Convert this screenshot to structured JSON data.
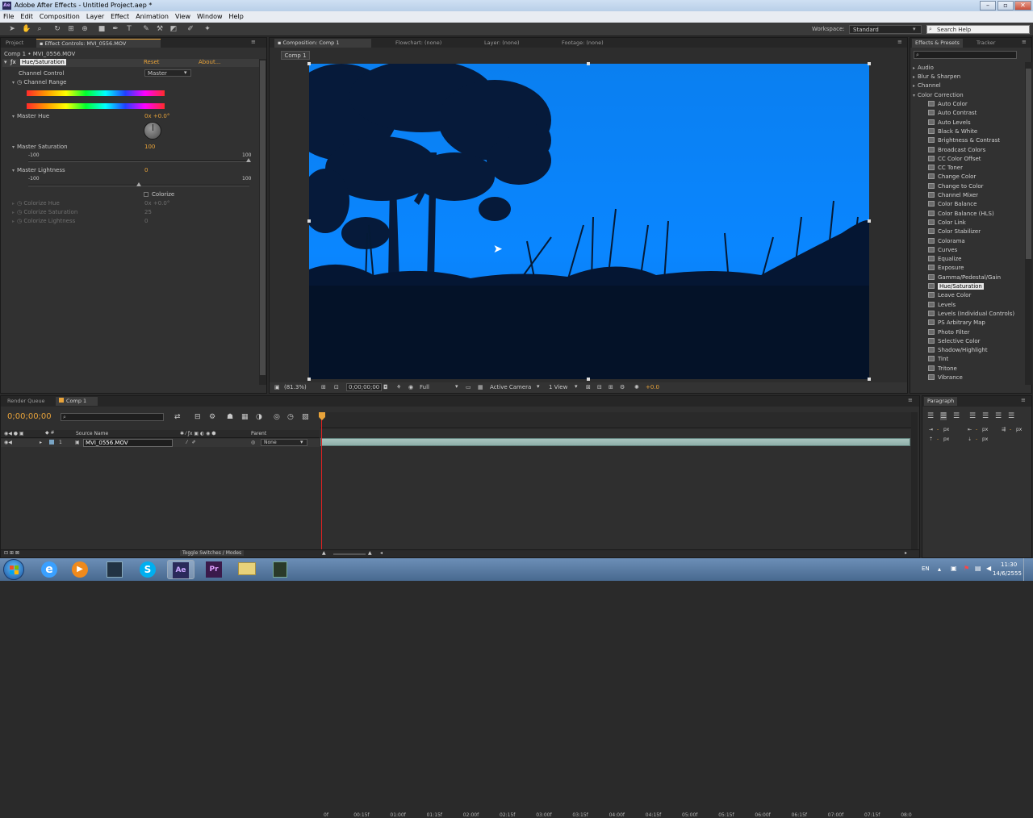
{
  "window": {
    "title": "Adobe After Effects - Untitled Project.aep *"
  },
  "menu": [
    "File",
    "Edit",
    "Composition",
    "Layer",
    "Effect",
    "Animation",
    "View",
    "Window",
    "Help"
  ],
  "toolbar": {
    "workspace_label": "Workspace:",
    "workspace_value": "Standard",
    "search_placeholder": "Search Help"
  },
  "left_panel": {
    "tabs": [
      "Project",
      "Effect Controls: MVI_0556.MOV"
    ],
    "breadcrumb": "Comp 1 • MVI_0556.MOV",
    "effect_name": "Hue/Saturation",
    "reset": "Reset",
    "about": "About...",
    "channel_control_label": "Channel Control",
    "channel_control_value": "Master",
    "channel_range_label": "Channel Range",
    "master_hue_label": "Master Hue",
    "master_hue_value": "0x +0.0°",
    "master_saturation_label": "Master Saturation",
    "master_saturation_value": "100",
    "sat_min": "-100",
    "sat_max": "100",
    "master_lightness_label": "Master Lightness",
    "master_lightness_value": "0",
    "light_min": "-100",
    "light_max": "100",
    "colorize_label": "Colorize",
    "colorize_hue_label": "Colorize Hue",
    "colorize_hue_value": "0x +0.0°",
    "colorize_saturation_label": "Colorize Saturation",
    "colorize_saturation_value": "25",
    "colorize_lightness_label": "Colorize Lightness",
    "colorize_lightness_value": "0"
  },
  "comp_panel": {
    "tabs": [
      "Composition: Comp 1",
      "Flowchart: (none)",
      "Layer: (none)",
      "Footage: (none)"
    ],
    "comp_tab": "Comp 1",
    "zoom": "(81.3%)",
    "timecode": "0;00;00;00",
    "resolution": "Full",
    "camera": "Active Camera",
    "view": "1 View",
    "exposure": "+0.0"
  },
  "right_panel": {
    "tabs": [
      "Effects & Presets",
      "Tracker"
    ],
    "categories": [
      "Audio",
      "Blur & Sharpen",
      "Channel",
      "Color Correction"
    ],
    "effects": [
      "Auto Color",
      "Auto Contrast",
      "Auto Levels",
      "Black & White",
      "Brightness & Contrast",
      "Broadcast Colors",
      "CC Color Offset",
      "CC Toner",
      "Change Color",
      "Change to Color",
      "Channel Mixer",
      "Color Balance",
      "Color Balance (HLS)",
      "Color Link",
      "Color Stabilizer",
      "Colorama",
      "Curves",
      "Equalize",
      "Exposure",
      "Gamma/Pedestal/Gain",
      "Hue/Saturation",
      "Leave Color",
      "Levels",
      "Levels (Individual Controls)",
      "PS Arbitrary Map",
      "Photo Filter",
      "Selective Color",
      "Shadow/Highlight",
      "Tint",
      "Tritone",
      "Vibrance"
    ],
    "selected_effect": "Hue/Saturation"
  },
  "timeline": {
    "tabs": [
      "Render Queue",
      "Comp 1"
    ],
    "timecode": "0;00;00;00",
    "col_source": "Source Name",
    "col_parent": "Parent",
    "layer_num": "1",
    "layer_name": "MVI_0556.MOV",
    "layer_parent": "None",
    "ruler": [
      "0f",
      "00:15f",
      "01:00f",
      "01:15f",
      "02:00f",
      "02:15f",
      "03:00f",
      "03:15f",
      "04:00f",
      "04:15f",
      "05:00f",
      "05:15f",
      "06:00f",
      "06:15f",
      "07:00f",
      "07:15f",
      "08:0"
    ],
    "toggle_label": "Toggle Switches / Modes"
  },
  "paragraph_panel": {
    "tab": "Paragraph",
    "px": "px"
  },
  "taskbar": {
    "lang": "EN",
    "time": "11:30",
    "date": "14/6/2555"
  }
}
